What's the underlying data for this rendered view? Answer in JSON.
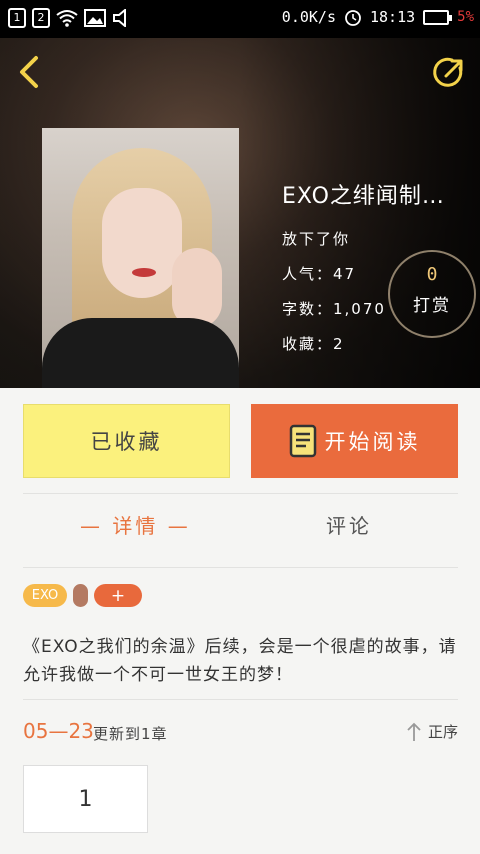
{
  "status_bar": {
    "sim1": "1",
    "sim2": "2",
    "speed": "0.0K/s",
    "time": "18:13",
    "battery_pct": "5%"
  },
  "book": {
    "title": "EXO之绯闻制…",
    "author": "放下了你",
    "popularity": "人气：47",
    "word_count": "字数：1,070",
    "favorites": "收藏：2"
  },
  "tip": {
    "count": "0",
    "label": "打赏"
  },
  "actions": {
    "favorited": "已收藏",
    "start_reading": "开始阅读"
  },
  "tabs": {
    "detail": "— 详情 —",
    "comment": "评论"
  },
  "tags": {
    "exo": "EXO",
    "add": "+"
  },
  "description": "《EXO之我们的余温》后续，会是一个很虐的故事，请允许我做一个不可一世女王的梦！",
  "update": {
    "date": "05—23",
    "text": "更新到1章",
    "order": "正序"
  },
  "chapters": [
    "1"
  ],
  "colors": {
    "accent": "#e8743f",
    "read_button": "#ea6b3d",
    "fav_button": "#fbf17d"
  }
}
